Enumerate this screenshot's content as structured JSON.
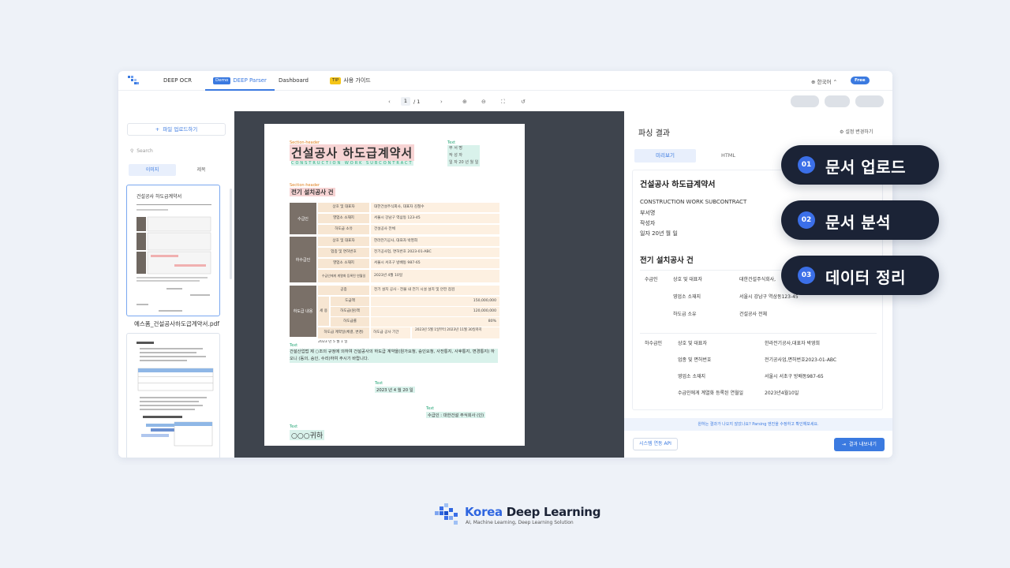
{
  "nav": {
    "tabs": [
      {
        "label": "DEEP OCR"
      },
      {
        "badge": "Demo",
        "label": "DEEP Parser"
      },
      {
        "label": "Dashboard"
      },
      {
        "badge": "TIP",
        "label": "사용 가이드"
      }
    ],
    "language": "한국어",
    "plan_badge": "Free"
  },
  "toolbar": {
    "page_current": "1",
    "page_total": "/ 1"
  },
  "sidebar": {
    "upload_label": "파일 업로드하기",
    "search_placeholder": "Search",
    "tab_image": "이미지",
    "tab_title": "제목",
    "file_name": "예스폼_건설공사하도급계약서.pdf"
  },
  "document": {
    "label_section_header": "Section-header",
    "label_text": "Text",
    "title": "건설공사 하도급계약서",
    "subtitle": "CONSTRUCTION WORK SUBCONTRACT",
    "approval": [
      "부 서 명",
      "작 성 자",
      "일 자   20   년   월   일"
    ],
    "section_title": "전기 설치공사 건",
    "contractor": "수급인",
    "subcontractor": "하수급인",
    "contract_content": "하도급 내용",
    "rows_contractor": [
      {
        "label": "상호 및 대표자",
        "value": "대한건설주식회사, 대표자 김철수"
      },
      {
        "label": "영업소 소재지",
        "value": "서울시 강남구 역삼동 123-45"
      },
      {
        "label": "하도급 소유",
        "value": "건설공사 전체"
      }
    ],
    "rows_sub": [
      {
        "label": "상호 및 대표자",
        "value": "한라전기공사, 대표자 박영희"
      },
      {
        "label": "업종 및 면허번호",
        "value": "전기공사업, 면허번호 2023-01-ABC"
      },
      {
        "label": "영업소 소재지",
        "value": "서울시 서초구 방배동 987-65"
      },
      {
        "label": "수급인에게 계열화 등록된 연월일",
        "value": "2023년 4월 10일"
      }
    ],
    "rows_content": [
      {
        "label": "공종",
        "value": "전기 설치 공사 - 전물 내 전기 시설 설치 및 안전 점검"
      },
      {
        "label": "도급액",
        "value": "150,000,000"
      },
      {
        "label": "하도급(원)액",
        "value": "120,000,000"
      },
      {
        "label": "하도급률",
        "value": "80%"
      },
      {
        "label": "하도급 계약일(체결, 변경)",
        "value": "2023 년 5 월 1 일"
      },
      {
        "label": "하도급 공사 기간",
        "value": "2023년 5월 1일부터 2023년 11월 30일까지"
      }
    ],
    "content_side_label": "세 용",
    "paragraph": "건설산업법 제 ○조의 규정에 의하여 건설공사의 하도급 계약을(원가요청, 승인요청, 사전통지, 사후통지, 변경통지) 하오니 (동의, 승인, 수리)하여 주시기 바랍니다.",
    "date": "2023 년 4 월 20 일",
    "signature": "수급인 :    대한건설 주식회사    (인)",
    "addressee": "○○○귀하"
  },
  "panel": {
    "title": "파싱 결과",
    "settings_label": "설정 변경하기",
    "tab_preview": "미리보기",
    "tab_html": "HTML",
    "h1": "건설공사 하도급계약서",
    "lines": [
      "CONSTRUCTION WORK SUBCONTRACT",
      "부서명",
      "작성자",
      "일자 20년 월 일"
    ],
    "h2": "전기 설치공사 건",
    "grid_contractor": {
      "group": "수급인",
      "rows": [
        {
          "label": "상호 및 대표자",
          "value": "대한건설주식회사,"
        },
        {
          "label": "영업소 소재지",
          "value": "서울시 강남구 역삼동123-45"
        },
        {
          "label": "하도급 소유",
          "value": "건설공사 전체"
        }
      ]
    },
    "grid_sub": {
      "group": "하수급인",
      "rows": [
        {
          "label": "상호 및 대표자",
          "value": "한라전기공사,대표자 박영희"
        },
        {
          "label": "업종 및 면허번호",
          "value": "전기공사업,면허번호2023-01-ABC"
        },
        {
          "label": "영업소 소재지",
          "value": "서울시 서초구 방배동987-65"
        },
        {
          "label": "수급인에게 계열화 등록된 연월일",
          "value": "2023년4월10일"
        }
      ]
    },
    "notice": "원하는 결과가 나오지 않았나요? Parsing 엔진을 수정하고 확인해보세요.",
    "api_button": "시스템 연동 API",
    "export_button": "결과 내보내기"
  },
  "steps": [
    {
      "num": "01",
      "label": "문서 업로드"
    },
    {
      "num": "02",
      "label": "문서 분석"
    },
    {
      "num": "03",
      "label": "데이터 정리"
    }
  ],
  "brand": {
    "name_accent": "Korea",
    "name_rest": " Deep Learning",
    "tagline": "AI, Machine Learning, Deep Learning Solution"
  },
  "colors": {
    "accent": "#3b7ae0",
    "step_bg": "#1b2336",
    "viewer_bg": "#3e444d"
  }
}
